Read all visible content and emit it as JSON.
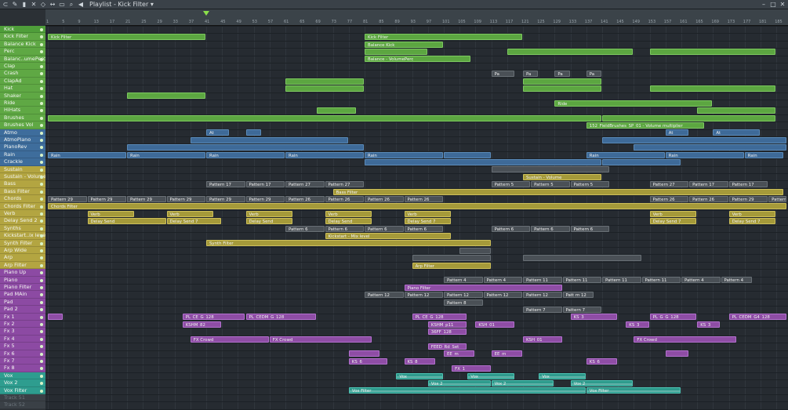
{
  "window": {
    "title": "Playlist - Kick Filter",
    "title_arrow": "▾"
  },
  "toolbar_icons": [
    "magnet-icon",
    "pencil-icon",
    "paint-icon",
    "delete-icon",
    "mute-icon",
    "slip-icon",
    "select-icon",
    "zoom-icon",
    "speaker-icon"
  ],
  "colors": {
    "green": "#5ca641",
    "blue": "#3e6a98",
    "yellow": "#a59a3a",
    "purple": "#8e4da5",
    "gray": "#4a5056",
    "teal": "#2e9a8c"
  },
  "timeline": {
    "bars": [
      "1",
      "5",
      "9",
      "13",
      "17",
      "21",
      "25",
      "29",
      "33",
      "37",
      "41",
      "45",
      "49",
      "53",
      "57",
      "61",
      "65",
      "69",
      "73",
      "77",
      "81",
      "85",
      "89",
      "93",
      "97",
      "101",
      "105",
      "109",
      "113",
      "117",
      "121",
      "125",
      "129",
      "133",
      "137",
      "141",
      "145",
      "149",
      "153",
      "157",
      "161",
      "165",
      "169",
      "173",
      "177",
      "181",
      "185",
      "189"
    ]
  },
  "tracks": [
    {
      "name": "Kick",
      "c": "#4f9e3a"
    },
    {
      "name": "Kick Filter",
      "c": "#5fa844"
    },
    {
      "name": "Balance Kick",
      "c": "#5fa844"
    },
    {
      "name": "Perc",
      "c": "#5fa844"
    },
    {
      "name": "Balanc..umePerc",
      "c": "#5fa844"
    },
    {
      "name": "Clap",
      "c": "#5fa844"
    },
    {
      "name": "Crash",
      "c": "#5fa844"
    },
    {
      "name": "ClapAd",
      "c": "#5fa844"
    },
    {
      "name": "Hat",
      "c": "#5fa844"
    },
    {
      "name": "Shaker",
      "c": "#5fa844"
    },
    {
      "name": "Ride",
      "c": "#5fa844"
    },
    {
      "name": "HiHats",
      "c": "#5fa844"
    },
    {
      "name": "Brushes",
      "c": "#5fa844"
    },
    {
      "name": "Brushes Vol",
      "c": "#5fa844"
    },
    {
      "name": "Atmo",
      "c": "#3e6d9c"
    },
    {
      "name": "AtmoPiano",
      "c": "#3e6d9c"
    },
    {
      "name": "PianoRev",
      "c": "#3e6d9c"
    },
    {
      "name": "Rain",
      "c": "#3e6d9c"
    },
    {
      "name": "Crackle",
      "c": "#3e6d9c"
    },
    {
      "name": "Sustain",
      "c": "#b3a541"
    },
    {
      "name": "Sustain - Volume",
      "c": "#b3a541"
    },
    {
      "name": "Bass",
      "c": "#b3a541"
    },
    {
      "name": "Bass Filter",
      "c": "#b3a541"
    },
    {
      "name": "Chords",
      "c": "#b3a541"
    },
    {
      "name": "Chords Filter",
      "c": "#b3a541"
    },
    {
      "name": "Verb",
      "c": "#b3a541"
    },
    {
      "name": "Delay Send 2",
      "c": "#b3a541"
    },
    {
      "name": "Synths",
      "c": "#b3a541"
    },
    {
      "name": "Kickstart..ix level",
      "c": "#b3a541"
    },
    {
      "name": "Synth Filter",
      "c": "#b3a541"
    },
    {
      "name": "Arp Wide",
      "c": "#b3a541"
    },
    {
      "name": "Arp",
      "c": "#b3a541"
    },
    {
      "name": "Arp Filter",
      "c": "#b3a541"
    },
    {
      "name": "Piano Up",
      "c": "#8c4aa3"
    },
    {
      "name": "Piano",
      "c": "#8c4aa3"
    },
    {
      "name": "Piano Filter",
      "c": "#8c4aa3"
    },
    {
      "name": "Pad MAin",
      "c": "#8c4aa3"
    },
    {
      "name": "Pad",
      "c": "#8c4aa3"
    },
    {
      "name": "Pad 2",
      "c": "#8c4aa3"
    },
    {
      "name": "Fx 1",
      "c": "#8c4aa3"
    },
    {
      "name": "Fx 2",
      "c": "#8c4aa3"
    },
    {
      "name": "Fx 3",
      "c": "#8c4aa3"
    },
    {
      "name": "Fx 4",
      "c": "#8c4aa3"
    },
    {
      "name": "Fx 5",
      "c": "#8c4aa3"
    },
    {
      "name": "Fx 6",
      "c": "#8c4aa3"
    },
    {
      "name": "Fx 7",
      "c": "#8c4aa3"
    },
    {
      "name": "Fx 8",
      "c": "#8c4aa3"
    },
    {
      "name": "Vox",
      "c": "#2e9d8f"
    },
    {
      "name": "Vox 2",
      "c": "#2e9d8f"
    },
    {
      "name": "Vox Filter",
      "c": "#2e9d8f"
    },
    {
      "name": "Track 51",
      "c": "#3a4046"
    },
    {
      "name": "Track 52",
      "c": "#3a4046"
    }
  ],
  "clips": [
    {
      "t": 1,
      "s": 1,
      "len": 40,
      "label": "Kick Filter",
      "k": "g"
    },
    {
      "t": 1,
      "s": 81,
      "len": 40,
      "label": "Kick Filter",
      "k": "g"
    },
    {
      "t": 2,
      "s": 81,
      "len": 20,
      "label": "Balance Kick",
      "k": "g"
    },
    {
      "t": 3,
      "s": 81,
      "len": 16,
      "label": "",
      "k": "g"
    },
    {
      "t": 3,
      "s": 117,
      "len": 32,
      "label": "",
      "k": "g"
    },
    {
      "t": 3,
      "s": 153,
      "len": 32,
      "label": "",
      "k": "g"
    },
    {
      "t": 4,
      "s": 81,
      "len": 27,
      "label": "Balance - VolumePerc",
      "k": "g"
    },
    {
      "t": 6,
      "s": 113,
      "len": 6,
      "label": "Pa",
      "k": "gr"
    },
    {
      "t": 6,
      "s": 121,
      "len": 4,
      "label": "Pa",
      "k": "gr"
    },
    {
      "t": 6,
      "s": 129,
      "len": 4,
      "label": "Pa",
      "k": "gr"
    },
    {
      "t": 6,
      "s": 137,
      "len": 4,
      "label": "Pa",
      "k": "gr"
    },
    {
      "t": 7,
      "s": 61,
      "len": 20,
      "label": "",
      "k": "g"
    },
    {
      "t": 7,
      "s": 121,
      "len": 20,
      "label": "",
      "k": "g"
    },
    {
      "t": 8,
      "s": 61,
      "len": 20,
      "label": "",
      "k": "g"
    },
    {
      "t": 8,
      "s": 121,
      "len": 20,
      "label": "",
      "k": "g"
    },
    {
      "t": 8,
      "s": 153,
      "len": 32,
      "label": "",
      "k": "g"
    },
    {
      "t": 9,
      "s": 21,
      "len": 20,
      "label": "",
      "k": "g"
    },
    {
      "t": 10,
      "s": 129,
      "len": 40,
      "label": "Ride",
      "k": "g"
    },
    {
      "t": 11,
      "s": 69,
      "len": 10,
      "label": "",
      "k": "g"
    },
    {
      "t": 11,
      "s": 165,
      "len": 20,
      "label": "",
      "k": "g"
    },
    {
      "t": 12,
      "s": 1,
      "len": 140,
      "label": "",
      "k": "g"
    },
    {
      "t": 12,
      "s": 141,
      "len": 44,
      "label": "",
      "k": "g"
    },
    {
      "t": 13,
      "s": 137,
      "len": 30,
      "label": "152_FieldBrushes_SP_01 - Volume multiplier",
      "k": "g"
    },
    {
      "t": 14,
      "s": 41,
      "len": 6,
      "label": "At",
      "k": "b"
    },
    {
      "t": 14,
      "s": 51,
      "len": 4,
      "label": "",
      "k": "b"
    },
    {
      "t": 14,
      "s": 157,
      "len": 6,
      "label": "At",
      "k": "b"
    },
    {
      "t": 14,
      "s": 169,
      "len": 12,
      "label": "At",
      "k": "b"
    },
    {
      "t": 15,
      "s": 37,
      "len": 40,
      "label": "",
      "k": "b"
    },
    {
      "t": 15,
      "s": 141,
      "len": 48,
      "label": "",
      "k": "b"
    },
    {
      "t": 16,
      "s": 21,
      "len": 60,
      "label": "",
      "k": "b"
    },
    {
      "t": 16,
      "s": 149,
      "len": 40,
      "label": "",
      "k": "b"
    },
    {
      "t": 17,
      "s": 1,
      "len": 20,
      "label": "Rain",
      "k": "b"
    },
    {
      "t": 17,
      "s": 21,
      "len": 20,
      "label": "Rain",
      "k": "b"
    },
    {
      "t": 17,
      "s": 41,
      "len": 20,
      "label": "Rain",
      "k": "b"
    },
    {
      "t": 17,
      "s": 61,
      "len": 20,
      "label": "Rain",
      "k": "b"
    },
    {
      "t": 17,
      "s": 81,
      "len": 20,
      "label": "Rain",
      "k": "b"
    },
    {
      "t": 17,
      "s": 101,
      "len": 12,
      "label": "",
      "k": "b"
    },
    {
      "t": 17,
      "s": 137,
      "len": 20,
      "label": "Rain",
      "k": "b"
    },
    {
      "t": 17,
      "s": 157,
      "len": 20,
      "label": "Rain",
      "k": "b"
    },
    {
      "t": 17,
      "s": 177,
      "len": 10,
      "label": "Rain",
      "k": "b"
    },
    {
      "t": 18,
      "s": 81,
      "len": 60,
      "label": "",
      "k": "b"
    },
    {
      "t": 18,
      "s": 141,
      "len": 20,
      "label": "",
      "k": "b"
    },
    {
      "t": 19,
      "s": 113,
      "len": 30,
      "label": "",
      "k": "gr"
    },
    {
      "t": 20,
      "s": 121,
      "len": 20,
      "label": "Sustain - Volume",
      "k": "y"
    },
    {
      "t": 21,
      "s": 41,
      "len": 10,
      "label": "Pattern 17",
      "k": "gr"
    },
    {
      "t": 21,
      "s": 51,
      "len": 10,
      "label": "Pattern 17",
      "k": "gr"
    },
    {
      "t": 21,
      "s": 61,
      "len": 10,
      "label": "Pattern 27",
      "k": "gr"
    },
    {
      "t": 21,
      "s": 71,
      "len": 10,
      "label": "Pattern 27",
      "k": "gr"
    },
    {
      "t": 21,
      "s": 113,
      "len": 10,
      "label": "Pattern 5",
      "k": "gr"
    },
    {
      "t": 21,
      "s": 123,
      "len": 10,
      "label": "Pattern 5",
      "k": "gr"
    },
    {
      "t": 21,
      "s": 133,
      "len": 10,
      "label": "Pattern 5",
      "k": "gr"
    },
    {
      "t": 21,
      "s": 153,
      "len": 10,
      "label": "Pattern 27",
      "k": "gr"
    },
    {
      "t": 21,
      "s": 163,
      "len": 10,
      "label": "Pattern 17",
      "k": "gr"
    },
    {
      "t": 21,
      "s": 173,
      "len": 10,
      "label": "Pattern 17",
      "k": "gr"
    },
    {
      "t": 22,
      "s": 73,
      "len": 114,
      "label": "Bass Filter",
      "k": "y"
    },
    {
      "t": 23,
      "s": 1,
      "len": 10,
      "label": "Pattern 29",
      "k": "gr"
    },
    {
      "t": 23,
      "s": 11,
      "len": 10,
      "label": "Pattern 29",
      "k": "gr"
    },
    {
      "t": 23,
      "s": 21,
      "len": 10,
      "label": "Pattern 29",
      "k": "gr"
    },
    {
      "t": 23,
      "s": 31,
      "len": 10,
      "label": "Pattern 29",
      "k": "gr"
    },
    {
      "t": 23,
      "s": 41,
      "len": 10,
      "label": "Pattern 29",
      "k": "gr"
    },
    {
      "t": 23,
      "s": 51,
      "len": 10,
      "label": "Pattern 29",
      "k": "gr"
    },
    {
      "t": 23,
      "s": 61,
      "len": 10,
      "label": "Pattern 26",
      "k": "gr"
    },
    {
      "t": 23,
      "s": 71,
      "len": 10,
      "label": "Pattern 26",
      "k": "gr"
    },
    {
      "t": 23,
      "s": 81,
      "len": 10,
      "label": "Pattern 26",
      "k": "gr"
    },
    {
      "t": 23,
      "s": 91,
      "len": 10,
      "label": "Pattern 26",
      "k": "gr"
    },
    {
      "t": 23,
      "s": 153,
      "len": 10,
      "label": "Pattern 26",
      "k": "gr"
    },
    {
      "t": 23,
      "s": 163,
      "len": 10,
      "label": "Pattern 26",
      "k": "gr"
    },
    {
      "t": 23,
      "s": 173,
      "len": 10,
      "label": "Pattern 29",
      "k": "gr"
    },
    {
      "t": 23,
      "s": 183,
      "len": 6,
      "label": "Pattern 29",
      "k": "gr"
    },
    {
      "t": 24,
      "s": 1,
      "len": 188,
      "label": "Chords Filter",
      "k": "y"
    },
    {
      "t": 25,
      "s": 11,
      "len": 12,
      "label": "Verb",
      "k": "y"
    },
    {
      "t": 25,
      "s": 31,
      "len": 12,
      "label": "Verb",
      "k": "y"
    },
    {
      "t": 25,
      "s": 51,
      "len": 12,
      "label": "Verb",
      "k": "y"
    },
    {
      "t": 25,
      "s": 71,
      "len": 12,
      "label": "Verb",
      "k": "y"
    },
    {
      "t": 25,
      "s": 91,
      "len": 12,
      "label": "Verb",
      "k": "y"
    },
    {
      "t": 25,
      "s": 153,
      "len": 12,
      "label": "Verb",
      "k": "y"
    },
    {
      "t": 25,
      "s": 173,
      "len": 12,
      "label": "Verb",
      "k": "y"
    },
    {
      "t": 26,
      "s": 11,
      "len": 20,
      "label": "Delay Send",
      "k": "y"
    },
    {
      "t": 26,
      "s": 31,
      "len": 14,
      "label": "Delay Send 7",
      "k": "y"
    },
    {
      "t": 26,
      "s": 51,
      "len": 12,
      "label": "Delay Send",
      "k": "y"
    },
    {
      "t": 26,
      "s": 71,
      "len": 12,
      "label": "Delay Send",
      "k": "y"
    },
    {
      "t": 26,
      "s": 91,
      "len": 12,
      "label": "Delay Send 7",
      "k": "y"
    },
    {
      "t": 26,
      "s": 153,
      "len": 12,
      "label": "Delay Send 7",
      "k": "y"
    },
    {
      "t": 26,
      "s": 173,
      "len": 12,
      "label": "Delay Send 7",
      "k": "y"
    },
    {
      "t": 27,
      "s": 61,
      "len": 10,
      "label": "Pattern 6",
      "k": "gr"
    },
    {
      "t": 27,
      "s": 71,
      "len": 10,
      "label": "Pattern 6",
      "k": "gr"
    },
    {
      "t": 27,
      "s": 81,
      "len": 10,
      "label": "Pattern 6",
      "k": "gr"
    },
    {
      "t": 27,
      "s": 91,
      "len": 10,
      "label": "Pattern 6",
      "k": "gr"
    },
    {
      "t": 27,
      "s": 113,
      "len": 10,
      "label": "Pattern 6",
      "k": "gr"
    },
    {
      "t": 27,
      "s": 123,
      "len": 10,
      "label": "Pattern 6",
      "k": "gr"
    },
    {
      "t": 27,
      "s": 133,
      "len": 10,
      "label": "Pattern 6",
      "k": "gr"
    },
    {
      "t": 28,
      "s": 71,
      "len": 32,
      "label": "Kickstart - Mix level",
      "k": "y"
    },
    {
      "t": 29,
      "s": 41,
      "len": 72,
      "label": "Synth Filter",
      "k": "y"
    },
    {
      "t": 30,
      "s": 105,
      "len": 8,
      "label": "",
      "k": "gr"
    },
    {
      "t": 31,
      "s": 93,
      "len": 20,
      "label": "",
      "k": "gr"
    },
    {
      "t": 31,
      "s": 121,
      "len": 30,
      "label": "",
      "k": "gr"
    },
    {
      "t": 32,
      "s": 93,
      "len": 20,
      "label": "Arp Filter",
      "k": "y"
    },
    {
      "t": 34,
      "s": 101,
      "len": 10,
      "label": "Pattern 4",
      "k": "gr"
    },
    {
      "t": 34,
      "s": 111,
      "len": 10,
      "label": "Pattern 4",
      "k": "gr"
    },
    {
      "t": 34,
      "s": 121,
      "len": 10,
      "label": "Pattern 11",
      "k": "gr"
    },
    {
      "t": 34,
      "s": 131,
      "len": 10,
      "label": "Pattern 11",
      "k": "gr"
    },
    {
      "t": 34,
      "s": 141,
      "len": 10,
      "label": "Pattern 11",
      "k": "gr"
    },
    {
      "t": 34,
      "s": 151,
      "len": 10,
      "label": "Pattern 11",
      "k": "gr"
    },
    {
      "t": 34,
      "s": 161,
      "len": 10,
      "label": "Pattern 4",
      "k": "gr"
    },
    {
      "t": 34,
      "s": 171,
      "len": 8,
      "label": "Pattern 4",
      "k": "gr"
    },
    {
      "t": 35,
      "s": 91,
      "len": 40,
      "label": "Piano Filter",
      "k": "p"
    },
    {
      "t": 36,
      "s": 81,
      "len": 10,
      "label": "Pattern 12",
      "k": "gr"
    },
    {
      "t": 36,
      "s": 91,
      "len": 10,
      "label": "Pattern 12",
      "k": "gr"
    },
    {
      "t": 36,
      "s": 101,
      "len": 10,
      "label": "Pattern 12",
      "k": "gr"
    },
    {
      "t": 36,
      "s": 111,
      "len": 10,
      "label": "Pattern 12",
      "k": "gr"
    },
    {
      "t": 36,
      "s": 121,
      "len": 10,
      "label": "Pattern 12",
      "k": "gr"
    },
    {
      "t": 36,
      "s": 131,
      "len": 8,
      "label": "Patt rn 12",
      "k": "gr"
    },
    {
      "t": 37,
      "s": 101,
      "len": 10,
      "label": "Pattern 8",
      "k": "gr"
    },
    {
      "t": 38,
      "s": 121,
      "len": 10,
      "label": "Pattern 7",
      "k": "gr"
    },
    {
      "t": 38,
      "s": 131,
      "len": 10,
      "label": "Pattern 7",
      "k": "gr"
    },
    {
      "t": 39,
      "s": 1,
      "len": 4,
      "label": "",
      "k": "p"
    },
    {
      "t": 39,
      "s": 35,
      "len": 16,
      "label": "PL_CE_G_128",
      "k": "p"
    },
    {
      "t": 39,
      "s": 51,
      "len": 18,
      "label": "PL_CEDM_G_128",
      "k": "p"
    },
    {
      "t": 39,
      "s": 93,
      "len": 14,
      "label": "PL_CE_G_128",
      "k": "p"
    },
    {
      "t": 39,
      "s": 133,
      "len": 12,
      "label": "KS_3",
      "k": "p"
    },
    {
      "t": 39,
      "s": 153,
      "len": 12,
      "label": "PL_G_G_128",
      "k": "p"
    },
    {
      "t": 39,
      "s": 173,
      "len": 16,
      "label": "PL_CEDM_G4_128",
      "k": "p"
    },
    {
      "t": 40,
      "s": 35,
      "len": 10,
      "label": "KSHM_82",
      "k": "p"
    },
    {
      "t": 40,
      "s": 97,
      "len": 10,
      "label": "KSHM_p11",
      "k": "p"
    },
    {
      "t": 40,
      "s": 109,
      "len": 10,
      "label": "KSH_01",
      "k": "p"
    },
    {
      "t": 40,
      "s": 147,
      "len": 6,
      "label": "KS_3",
      "k": "p"
    },
    {
      "t": 40,
      "s": 165,
      "len": 6,
      "label": "KS_3",
      "k": "p"
    },
    {
      "t": 41,
      "s": 97,
      "len": 10,
      "label": "36FF_128",
      "k": "p"
    },
    {
      "t": 42,
      "s": 37,
      "len": 20,
      "label": "FX Crowd",
      "k": "p"
    },
    {
      "t": 42,
      "s": 57,
      "len": 26,
      "label": "FX Crowd",
      "k": "p"
    },
    {
      "t": 42,
      "s": 121,
      "len": 10,
      "label": "KSH_01",
      "k": "p"
    },
    {
      "t": 42,
      "s": 149,
      "len": 26,
      "label": "FX Crowd",
      "k": "p"
    },
    {
      "t": 43,
      "s": 97,
      "len": 10,
      "label": "FEED_Rd_Set",
      "k": "p"
    },
    {
      "t": 44,
      "s": 77,
      "len": 8,
      "label": "",
      "k": "p"
    },
    {
      "t": 44,
      "s": 101,
      "len": 8,
      "label": "EE_m",
      "k": "p"
    },
    {
      "t": 44,
      "s": 113,
      "len": 8,
      "label": "EE_m",
      "k": "p"
    },
    {
      "t": 44,
      "s": 157,
      "len": 6,
      "label": "",
      "k": "p"
    },
    {
      "t": 45,
      "s": 77,
      "len": 10,
      "label": "KS_6",
      "k": "p"
    },
    {
      "t": 45,
      "s": 91,
      "len": 8,
      "label": "KS_8",
      "k": "p"
    },
    {
      "t": 45,
      "s": 137,
      "len": 8,
      "label": "KS_6",
      "k": "p"
    },
    {
      "t": 46,
      "s": 103,
      "len": 10,
      "label": "FX_1",
      "k": "p"
    },
    {
      "t": 47,
      "s": 89,
      "len": 12,
      "label": "Vox",
      "k": "t"
    },
    {
      "t": 47,
      "s": 107,
      "len": 12,
      "label": "Vox",
      "k": "t"
    },
    {
      "t": 47,
      "s": 125,
      "len": 12,
      "label": "Vox",
      "k": "t"
    },
    {
      "t": 48,
      "s": 97,
      "len": 16,
      "label": "Vox 2",
      "k": "t"
    },
    {
      "t": 48,
      "s": 113,
      "len": 16,
      "label": "Vox 2",
      "k": "t"
    },
    {
      "t": 48,
      "s": 133,
      "len": 16,
      "label": "Vox 2",
      "k": "t"
    },
    {
      "t": 49,
      "s": 77,
      "len": 60,
      "label": "Vox Filter",
      "k": "t"
    },
    {
      "t": 49,
      "s": 137,
      "len": 24,
      "label": "Vox Filter",
      "k": "t"
    }
  ]
}
